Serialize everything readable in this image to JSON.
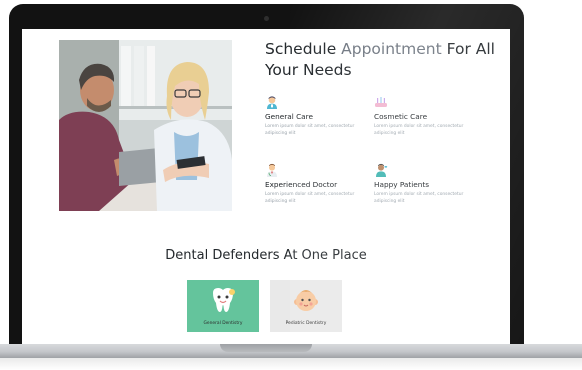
{
  "schedule": {
    "title_main": "Schedule ",
    "title_accent": "Appointment",
    "title_rest": " For All Your Needs"
  },
  "features": [
    {
      "icon": "nurse-icon",
      "title": "General Care",
      "desc": "Lorem ipsum dolor sit amet, consectetur adipiscing elit"
    },
    {
      "icon": "dental-tools-icon",
      "title": "Cosmetic Care",
      "desc": "Lorem ipsum dolor sit amet, consectetur adipiscing elit"
    },
    {
      "icon": "doctor-icon",
      "title": "Experienced Doctor",
      "desc": "Lorem ipsum dolor sit amet, consectetur adipiscing elit"
    },
    {
      "icon": "happy-patient-icon",
      "title": "Happy Patients",
      "desc": "Lorem ipsum dolor sit amet, consectetur adipiscing elit"
    }
  ],
  "services": {
    "title": "Dental Defenders At One Place",
    "cards": [
      {
        "label": "General Dentistry",
        "color": "#64c49c",
        "icon": "tooth-icon"
      },
      {
        "label": "Pediatric Dentistry",
        "color": "#e9e9e9",
        "icon": "baby-face-icon"
      }
    ]
  },
  "colors": {
    "laptop_frame": "#121212",
    "heading": "#24292d",
    "accent_text": "#6f7680",
    "body_text": "#9aa3ab"
  }
}
